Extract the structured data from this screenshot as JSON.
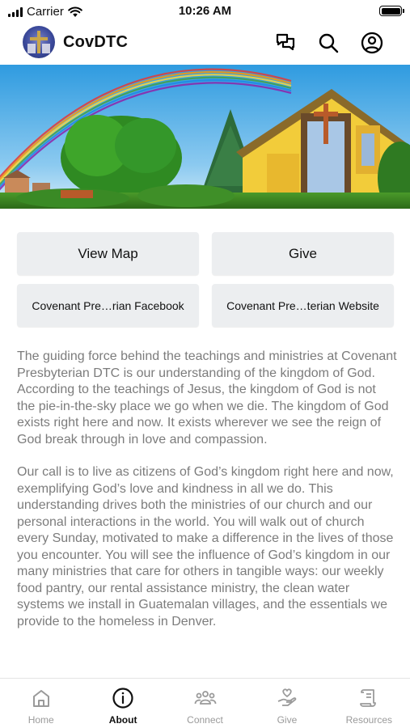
{
  "status_bar": {
    "carrier": "Carrier",
    "time": "10:26 AM"
  },
  "header": {
    "title": "CovDTC",
    "icons": [
      "chat-icon",
      "search-icon",
      "account-icon"
    ]
  },
  "buttons": {
    "view_map": "View Map",
    "give": "Give",
    "facebook": "Covenant Pre…rian Facebook",
    "website": "Covenant Pre…terian Website"
  },
  "content": {
    "paragraph_1": "The guiding force behind the teachings and ministries at Covenant Presbyterian DTC is our understanding of the kingdom of God. According to the teachings of Jesus, the kingdom of God is not the pie-in-the-sky place we go when we die. The kingdom of God exists right here and now. It exists wherever we see the reign of God break through in love and compassion.",
    "paragraph_2": "Our call is to live as citizens of God’s kingdom right here and now, exemplifying God’s love and kindness in all we do. This understanding drives both the ministries of our church and our personal interactions in the world. You will walk out of church every Sunday, motivated to make a difference in the lives of those you encounter. You will see the influence of God’s kingdom in our many ministries that care for others in tangible ways: our weekly food pantry, our rental assistance ministry, the clean water systems we install in Guatemalan villages, and the essentials we provide to the homeless in Denver."
  },
  "tabs": [
    {
      "label": "Home",
      "icon": "home-icon",
      "active": false
    },
    {
      "label": "About",
      "icon": "info-icon",
      "active": true
    },
    {
      "label": "Connect",
      "icon": "people-icon",
      "active": false
    },
    {
      "label": "Give",
      "icon": "hand-heart-icon",
      "active": false
    },
    {
      "label": "Resources",
      "icon": "scroll-icon",
      "active": false
    }
  ],
  "colors": {
    "body_text": "#7c7c7c",
    "button_bg": "#eceef0",
    "tab_inactive": "#9a9a9a",
    "tab_active": "#111111"
  }
}
